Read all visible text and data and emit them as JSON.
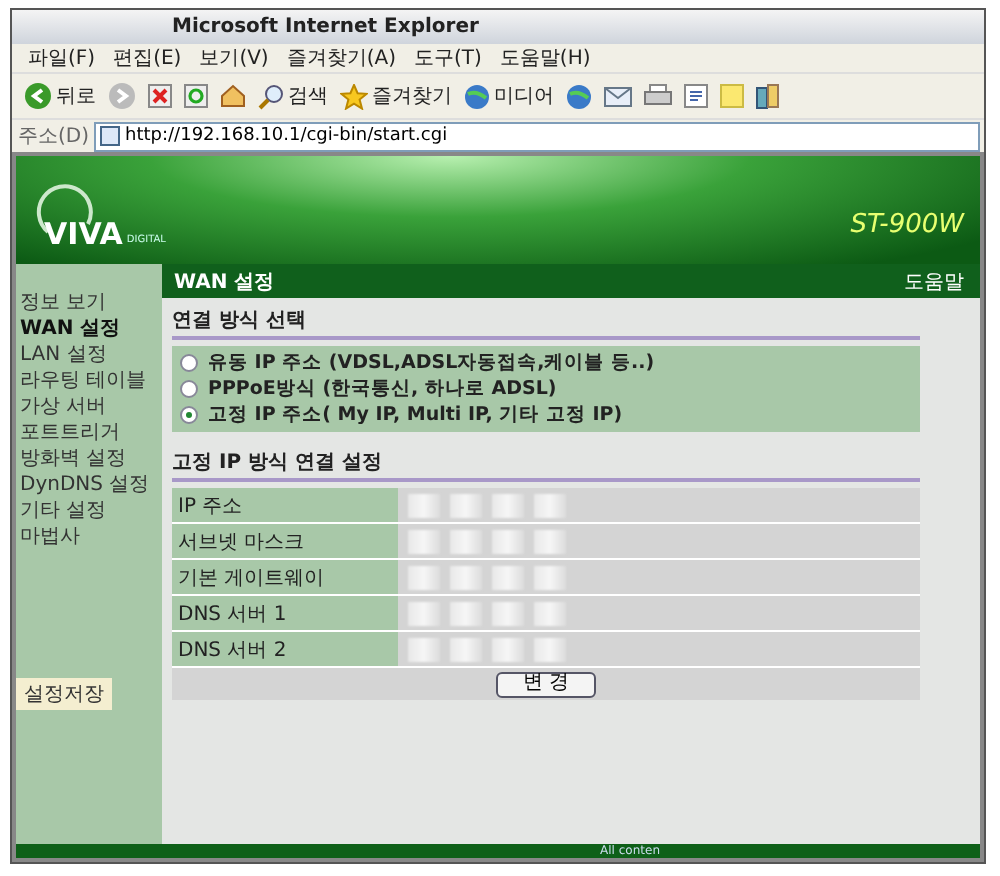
{
  "window": {
    "title": "Microsoft Internet Explorer"
  },
  "menu": [
    "파일(F)",
    "편집(E)",
    "보기(V)",
    "즐겨찾기(A)",
    "도구(T)",
    "도움말(H)"
  ],
  "toolbar": [
    {
      "kind": "back",
      "label": "뒤로"
    },
    {
      "kind": "forward"
    },
    {
      "kind": "stop"
    },
    {
      "kind": "refresh"
    },
    {
      "kind": "home"
    },
    {
      "kind": "search",
      "label": "검색"
    },
    {
      "kind": "favorites",
      "label": "즐겨찾기"
    },
    {
      "kind": "media",
      "label": "미디어"
    },
    {
      "kind": "history"
    },
    {
      "kind": "mail"
    },
    {
      "kind": "print"
    },
    {
      "kind": "edit"
    },
    {
      "kind": "note"
    },
    {
      "kind": "messenger"
    }
  ],
  "address": {
    "label": "주소(D)",
    "value": "http://192.168.10.1/cgi-bin/start.cgi"
  },
  "banner": {
    "logo": "VIVA",
    "logo_sub": "DIGITAL",
    "model": "ST-900W"
  },
  "header": {
    "title": "WAN 설정",
    "help": "도움말"
  },
  "sidebar": {
    "items": [
      {
        "label": "정보 보기",
        "selected": false
      },
      {
        "label": "WAN 설정",
        "selected": true
      },
      {
        "label": "LAN 설정",
        "selected": false
      },
      {
        "label": "라우팅 테이블",
        "selected": false
      },
      {
        "label": "가상 서버",
        "selected": false
      },
      {
        "label": "포트트리거",
        "selected": false
      },
      {
        "label": "방화벽 설정",
        "selected": false
      },
      {
        "label": "DynDNS 설정",
        "selected": false
      },
      {
        "label": "기타 설정",
        "selected": false
      },
      {
        "label": "마법사",
        "selected": false
      }
    ],
    "save": "설정저장"
  },
  "connection": {
    "title": "연결 방식 선택",
    "options": [
      {
        "label": "유동 IP 주소 (VDSL,ADSL자동접속,케이블 등..)",
        "selected": false
      },
      {
        "label": "PPPoE방식 (한국통신, 하나로 ADSL)",
        "selected": false
      },
      {
        "label": "고정 IP 주소( My IP, Multi IP, 기타 고정 IP)",
        "selected": true
      }
    ]
  },
  "static": {
    "title": "고정 IP 방식 연결 설정",
    "rows": [
      "IP 주소",
      "서브넷 마스크",
      "기본 게이트웨이",
      "DNS 서버 1",
      "DNS 서버 2"
    ],
    "button": "변 경"
  },
  "footer": "All conten"
}
